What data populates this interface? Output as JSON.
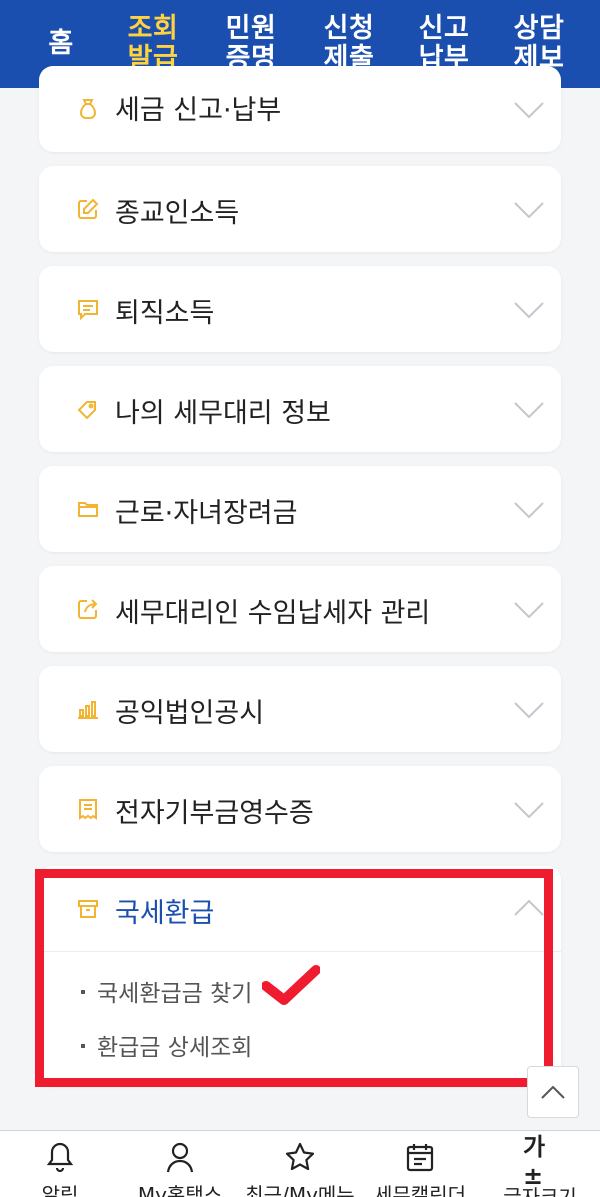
{
  "topnav": {
    "tabs": [
      {
        "label": "홈",
        "active": false
      },
      {
        "label": "조회\n발급",
        "active": true
      },
      {
        "label": "민원\n증명",
        "active": false
      },
      {
        "label": "신청\n제출",
        "active": false
      },
      {
        "label": "신고\n납부",
        "active": false
      },
      {
        "label": "상담\n제보",
        "active": false
      }
    ],
    "bg_color": "#1a4fb0",
    "active_color": "#ffd23f"
  },
  "menu": {
    "items": [
      {
        "label": "세금 신고·납부",
        "icon": "money-bag-icon"
      },
      {
        "label": "종교인소득",
        "icon": "edit-icon"
      },
      {
        "label": "퇴직소득",
        "icon": "message-icon"
      },
      {
        "label": "나의 세무대리 정보",
        "icon": "tag-icon"
      },
      {
        "label": "근로·자녀장려금",
        "icon": "folder-icon"
      },
      {
        "label": "세무대리인 수임납세자 관리",
        "icon": "external-link-icon"
      },
      {
        "label": "공익법인공시",
        "icon": "bar-chart-icon"
      },
      {
        "label": "전자기부금영수증",
        "icon": "receipt-icon"
      }
    ],
    "open_item": {
      "label": "국세환급",
      "icon": "archive-box-icon",
      "subitems": [
        {
          "label": "국세환급금 찾기"
        },
        {
          "label": "환급금 상세조회"
        }
      ]
    },
    "icon_color": "#f2b533",
    "active_label_color": "#1a4fb0"
  },
  "annotation": {
    "highlight_color": "#ef1b2f"
  },
  "bottombar": {
    "items": [
      {
        "label": "알림",
        "icon": "bell-icon"
      },
      {
        "label": "My홈택스",
        "icon": "user-icon"
      },
      {
        "label": "최근/My메뉴",
        "icon": "star-icon"
      },
      {
        "label": "세무캘린더",
        "icon": "calendar-icon"
      },
      {
        "label": "글자크기",
        "icon": "font-size-icon",
        "glyph": "가±"
      }
    ]
  }
}
